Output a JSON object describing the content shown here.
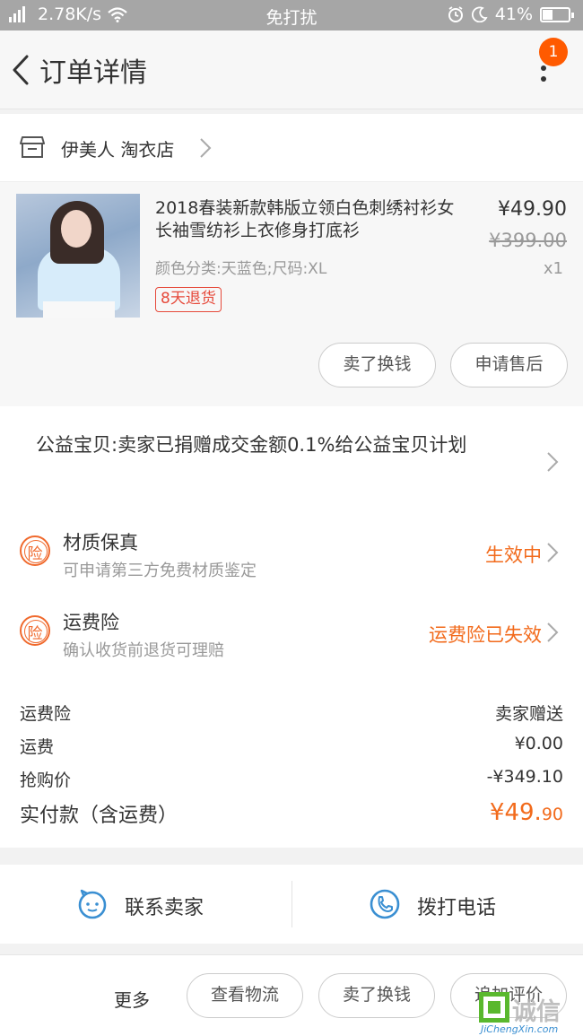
{
  "status_bar": {
    "speed": "2.78K/s",
    "mode": "免打扰",
    "battery": "41%"
  },
  "header": {
    "title": "订单详情",
    "badge_count": "1"
  },
  "shop": {
    "name": "伊美人 淘衣店"
  },
  "item": {
    "title": "2018春装新款韩版立领白色刺绣衬衫女长袖雪纺衫上衣修身打底衫",
    "variant": "颜色分类:天蓝色;尺码:XL",
    "return_policy": "8天退货",
    "price": "¥49.90",
    "original_price": "¥399.00",
    "quantity": "x1",
    "buttons": {
      "sell": "卖了换钱",
      "after_sale": "申请售后"
    }
  },
  "charity": {
    "text": "公益宝贝:卖家已捐赠成交金额0.1%给公益宝贝计划"
  },
  "insurance": {
    "icon_char": "险",
    "items": [
      {
        "title": "材质保真",
        "subtitle": "可申请第三方免费材质鉴定",
        "status": "生效中"
      },
      {
        "title": "运费险",
        "subtitle": "确认收货前退货可理赔",
        "status": "运费险已失效"
      }
    ]
  },
  "costs": {
    "rows": [
      {
        "label": "运费险",
        "value": "卖家赠送"
      },
      {
        "label": "运费",
        "value": "¥0.00"
      },
      {
        "label": "抢购价",
        "value": "-¥349.10"
      }
    ],
    "total_label": "实付款（含运费）",
    "total_main": "¥49.",
    "total_cents": "90"
  },
  "contact": {
    "seller": "联系卖家",
    "phone": "拨打电话"
  },
  "bottom_bar": {
    "more": "更多",
    "logistics": "查看物流",
    "sell": "卖了换钱",
    "review": "追加评价"
  },
  "watermark": {
    "text": "诚信",
    "site": "JiChengXin.com"
  },
  "colors": {
    "accent": "#f26a1b",
    "badge": "#ff5a00",
    "link_blue": "#3a8fd2"
  }
}
